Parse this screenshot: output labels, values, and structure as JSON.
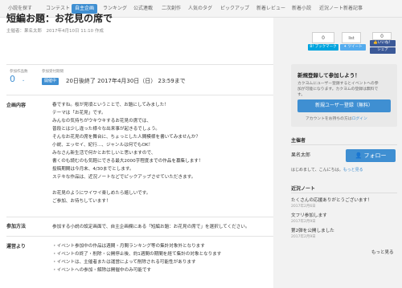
{
  "nav": [
    "小説を探す",
    "コンテスト",
    "自主企画",
    "ランキング",
    "公式連載",
    "二次創作",
    "人気のタグ",
    "ピックアップ",
    "新着レビュー",
    "新着小説",
    "近況ノート新着記事"
  ],
  "header": {
    "title": "短編お題：お花見の席で",
    "organizer": "主催者：果名太郎　2017年4月10日 11:10 作成"
  },
  "social": {
    "hatena_count": "0",
    "hatena_label": "B! ブックマーク",
    "list_label": "list",
    "tweet_label": "ツイート",
    "fb_count": "0",
    "fb_like": "いいね！",
    "fb_share": "シェア"
  },
  "stats": {
    "entries_label": "参加作品数",
    "entries_count": "0",
    "period_label": "参加受付期間",
    "status_badge": "開催中",
    "deadline": "20日後終了 2017年4月30日（日） 23:59まで"
  },
  "details": {
    "content_label": "企画内容",
    "content_lines": [
      "春ですね。桜が見頃ということで、お題にしてみました！",
      "テーマは「お花見」です。",
      "みんなの気持ちがウキウキするお花見の席では、",
      "普段とは少し違った様々な出来事が起きるでしょう。",
      "そんなお花見の席を舞台に、ちょっとした人間模様を書いてみませんか？",
      "小説、エッセイ、紀行…、ジャンルは何でもOK！",
      "みなさん新生活で何かとお忙しいと思いますので、",
      "書くのも読むのも気軽にできる最大2000字程度までの作品を募集します！",
      "投稿期間は今月末、4/30までとします。",
      "ステキな作品は、近況ノートなどでピックアップさせていただきます。",
      "",
      "お花見のようにワイワイ楽しめたら嬉しいです。",
      "ご参加、お待ちしています！"
    ],
    "method_label": "参加方法",
    "method_text": "参加する小説の設定画面で、自主企画欄にある「短編お題：お花見の席で」を選択してください。",
    "rules_label": "運営より",
    "rules_lines": [
      "・イベント参加中の作品は週間・月間ランキング等の集計対象外となります",
      "・イベントの終了・削除・公開停止後、約1週間の期間を経て集計の対象となります",
      "・イベントは、主催者または運営によって削除される可能性があります",
      "・イベントへの参加・解除は開催中のみ可能です"
    ]
  },
  "register": {
    "title": "新規登録して参加しよう！",
    "text1": "カクヨムにユーザー登録するとイベントへの参",
    "text2": "加が可能になります。カクヨムの登録は無料で",
    "text3": "す。",
    "button": "新規ユーザー登録（無料）",
    "login_prefix": "アカウントをお持ちの方は",
    "login_link": "ログイン"
  },
  "host": {
    "heading": "主催者",
    "name": "果名太郎",
    "follow": "フォロー",
    "message_prefix": "はじめまして、こんにちは。",
    "message_link": "もっと見る"
  },
  "notes": {
    "heading": "近況ノート",
    "items": [
      {
        "title": "たくさんの応援ありがとうございます！",
        "date": "2017年2月6日"
      },
      {
        "title": "文フリ参加します",
        "date": "2017年2月9日"
      },
      {
        "title": "第2弾を公開しました",
        "date": "2017年2月9日"
      }
    ],
    "more": "もっと見る"
  },
  "colors": {
    "accent": "#3f8fd2",
    "twitter": "#55acee",
    "facebook": "#3b5998",
    "hatena": "#00a4de"
  }
}
